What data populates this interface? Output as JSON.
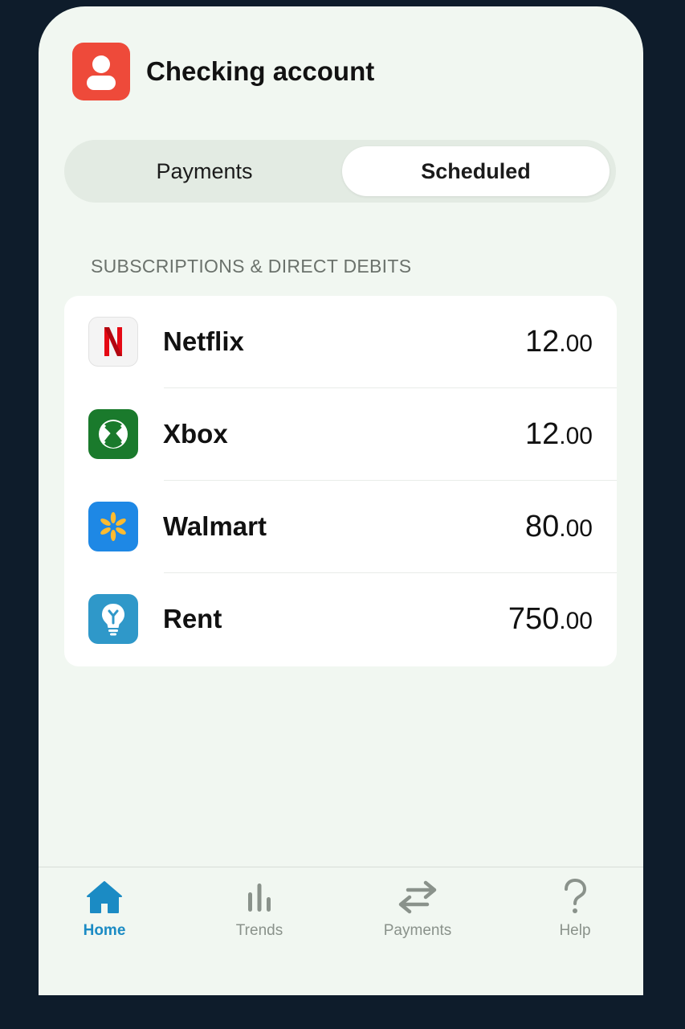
{
  "header": {
    "title": "Checking account",
    "icon": "user-icon",
    "icon_color": "#ee4a3a"
  },
  "segments": {
    "left_label": "Payments",
    "right_label": "Scheduled",
    "selected": "Scheduled"
  },
  "section": {
    "title": "SUBSCRIPTIONS & DIRECT DEBITS"
  },
  "items": [
    {
      "name": "Netflix",
      "amount_int": "12",
      "amount_dec": ".00",
      "icon": "netflix-icon",
      "color": "#e50914"
    },
    {
      "name": "Xbox",
      "amount_int": "12",
      "amount_dec": ".00",
      "icon": "xbox-icon",
      "color": "#1a7a2c"
    },
    {
      "name": "Walmart",
      "amount_int": "80",
      "amount_dec": ".00",
      "icon": "walmart-spark-icon",
      "color": "#1e88e5"
    },
    {
      "name": "Rent",
      "amount_int": "750",
      "amount_dec": ".00",
      "icon": "lightbulb-icon",
      "color": "#2f98c9"
    }
  ],
  "tabbar": {
    "tabs": [
      {
        "label": "Home",
        "icon": "home-icon",
        "active": true
      },
      {
        "label": "Trends",
        "icon": "bar-chart-icon",
        "active": false
      },
      {
        "label": "Payments",
        "icon": "transfer-arrows-icon",
        "active": false
      },
      {
        "label": "Help",
        "icon": "question-icon",
        "active": false
      }
    ],
    "active_color": "#1b8bc4",
    "inactive_color": "#8a928b"
  }
}
